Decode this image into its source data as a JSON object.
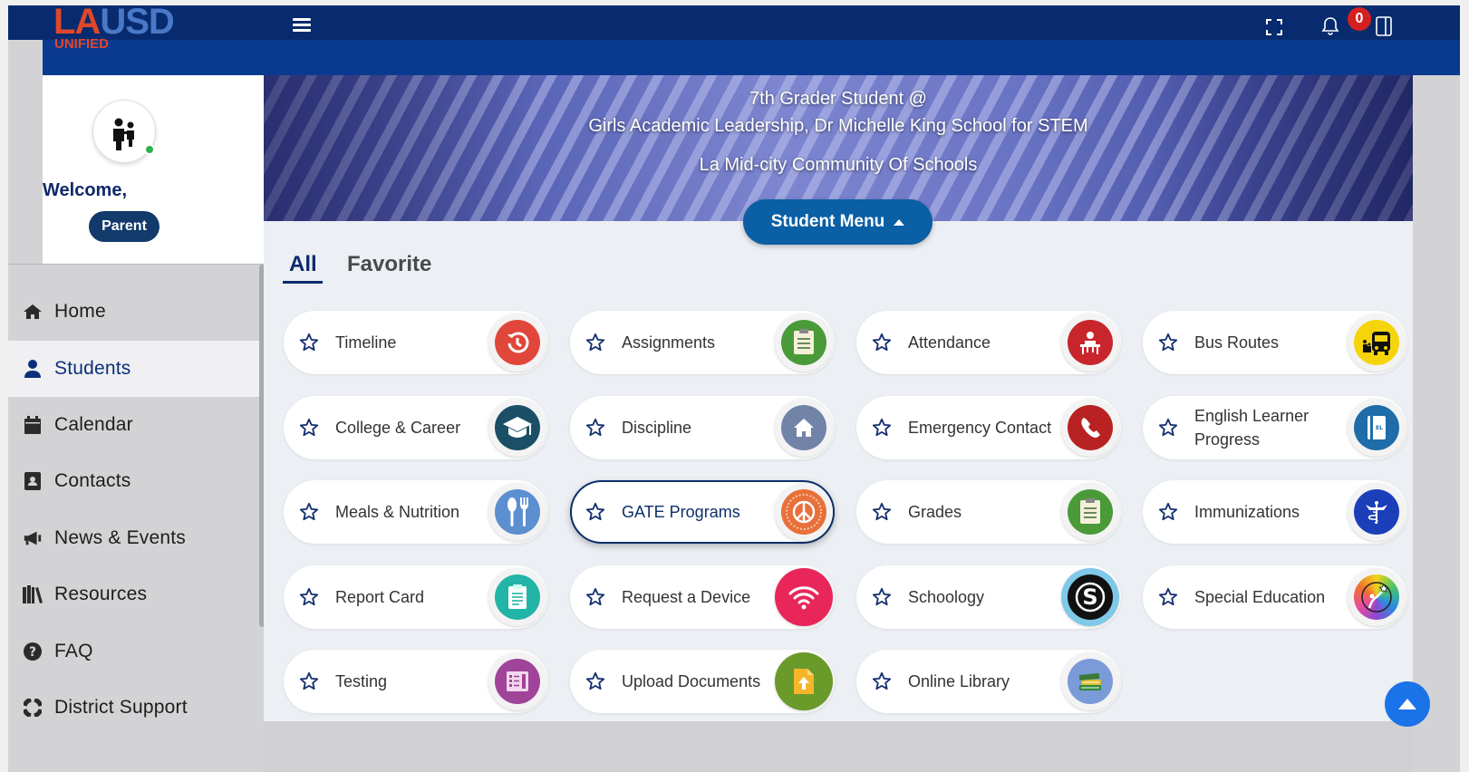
{
  "header": {
    "logo": "LAUSD",
    "logo_sub": "UNIFIED",
    "notification_count": "0"
  },
  "sidebar": {
    "welcome": "Welcome,",
    "role": "Parent",
    "items": [
      {
        "label": "Home",
        "icon": "home-icon"
      },
      {
        "label": "Students",
        "icon": "user-icon"
      },
      {
        "label": "Calendar",
        "icon": "calendar-icon"
      },
      {
        "label": "Contacts",
        "icon": "contact-card-icon"
      },
      {
        "label": "News & Events",
        "icon": "megaphone-icon"
      },
      {
        "label": "Resources",
        "icon": "books-icon"
      },
      {
        "label": "FAQ",
        "icon": "question-icon"
      },
      {
        "label": "District Support",
        "icon": "lifebuoy-icon"
      }
    ]
  },
  "banner": {
    "grade_line": "7th Grader Student @",
    "school": "Girls Academic Leadership, Dr Michelle King School for STEM",
    "community": "La Mid-city Community Of Schools",
    "menu_button": "Student Menu"
  },
  "tabs": {
    "all": "All",
    "favorite": "Favorite"
  },
  "cards": [
    {
      "label": "Timeline",
      "icon": "timeline-icon",
      "color": "#e0473a"
    },
    {
      "label": "Assignments",
      "icon": "assignments-icon",
      "color": "#4a9a3a"
    },
    {
      "label": "Attendance",
      "icon": "attendance-icon",
      "color": "#c8262c"
    },
    {
      "label": "Bus Routes",
      "icon": "bus-icon",
      "color": "#f5d40a"
    },
    {
      "label": "College & Career",
      "icon": "graduation-cap-icon",
      "color": "#1b4f66"
    },
    {
      "label": "Discipline",
      "icon": "house-icon",
      "color": "#7283a8"
    },
    {
      "label": "Emergency Contact",
      "icon": "phone-icon",
      "color": "#b82222"
    },
    {
      "label": "English Learner Progress",
      "icon": "book-icon",
      "color": "#1e6ca8"
    },
    {
      "label": "Meals & Nutrition",
      "icon": "fork-spoon-icon",
      "color": "#5c8fd0"
    },
    {
      "label": "GATE Programs",
      "icon": "peace-love-icon",
      "color": "#e8703a"
    },
    {
      "label": "Grades",
      "icon": "grades-icon",
      "color": "#4a9a3a"
    },
    {
      "label": "Immunizations",
      "icon": "medical-icon",
      "color": "#1a3fb8"
    },
    {
      "label": "Report Card",
      "icon": "report-card-icon",
      "color": "#23b4a8"
    },
    {
      "label": "Request a Device",
      "icon": "wifi-icon",
      "color": "#e8265a"
    },
    {
      "label": "Schoology",
      "icon": "schoology-icon",
      "color": "#111111"
    },
    {
      "label": "Special Education",
      "icon": "special-education-icon",
      "color": "#e84ca0"
    },
    {
      "label": "Testing",
      "icon": "testing-icon",
      "color": "#a0449a"
    },
    {
      "label": "Upload Documents",
      "icon": "upload-icon",
      "color": "#6a9a2a"
    },
    {
      "label": "Online Library",
      "icon": "library-icon",
      "color": "#7a9ad8"
    }
  ]
}
